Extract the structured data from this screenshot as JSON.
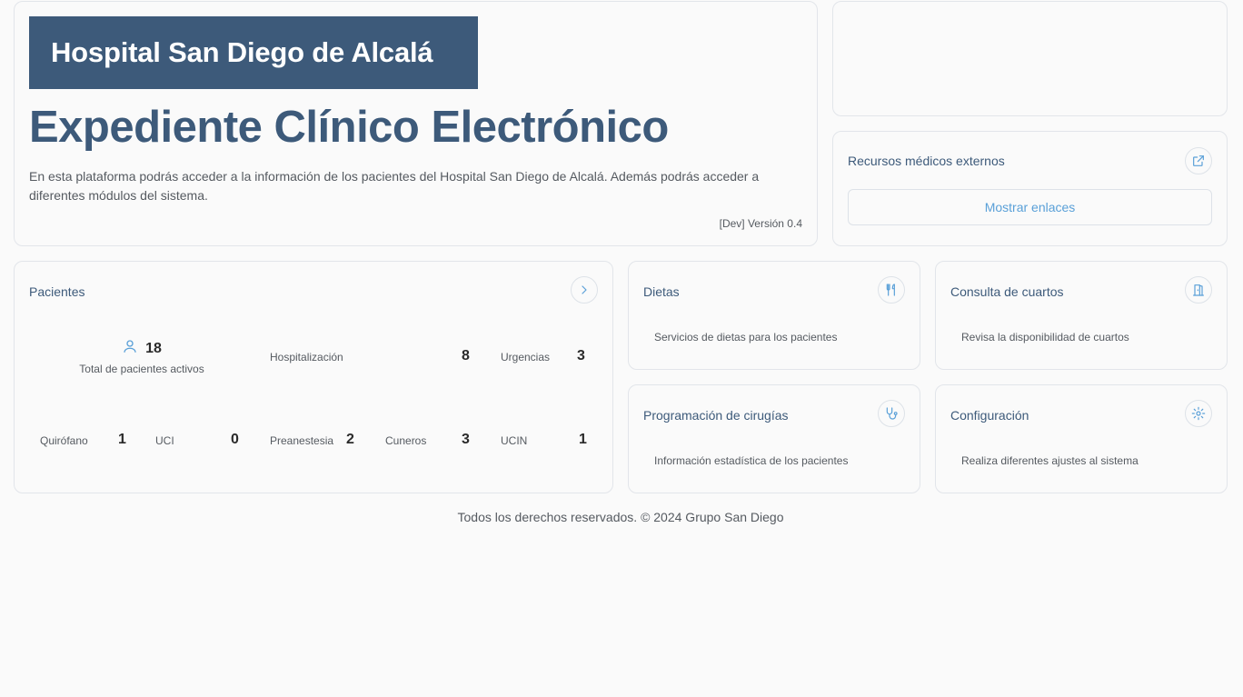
{
  "hero": {
    "brand": "Hospital San Diego de Alcalá",
    "title": "Expediente Clínico Electrónico",
    "description": "En esta plataforma podrás acceder a la información de los pacientes del Hospital San Diego de Alcalá. Además podrás acceder a diferentes módulos del sistema.",
    "version": "[Dev] Versión 0.4"
  },
  "resources": {
    "title": "Recursos médicos externos",
    "icon": "external-link-icon",
    "button_label": "Mostrar enlaces"
  },
  "patients": {
    "title": "Pacientes",
    "icon": "chevron-right-icon",
    "total_value": "18",
    "total_label": "Total de pacientes activos",
    "areas": [
      {
        "label": "Hospitalización",
        "value": "8"
      },
      {
        "label": "Urgencias",
        "value": "3"
      },
      {
        "label": "Quirófano",
        "value": "1"
      },
      {
        "label": "UCI",
        "value": "0"
      },
      {
        "label": "Preanestesia",
        "value": "2"
      },
      {
        "label": "Cuneros",
        "value": "3"
      },
      {
        "label": "UCIN",
        "value": "1"
      }
    ]
  },
  "modules": {
    "dietas": {
      "title": "Dietas",
      "description": "Servicios de dietas para los pacientes",
      "icon": "utensils-icon"
    },
    "cuartos": {
      "title": "Consulta de cuartos",
      "description": "Revisa la disponibilidad de cuartos",
      "icon": "door-icon"
    },
    "cirugias": {
      "title": "Programación de cirugías",
      "description": "Información estadística de los pacientes",
      "icon": "stethoscope-icon"
    },
    "config": {
      "title": "Configuración",
      "description": "Realiza diferentes ajustes al sistema",
      "icon": "gear-icon"
    }
  },
  "footer": {
    "text": "Todos los derechos reservados. © 2024 Grupo San Diego"
  },
  "colors": {
    "brand": "#3d5a7a",
    "accent": "#5aa0d8",
    "background": "#fafafa"
  }
}
